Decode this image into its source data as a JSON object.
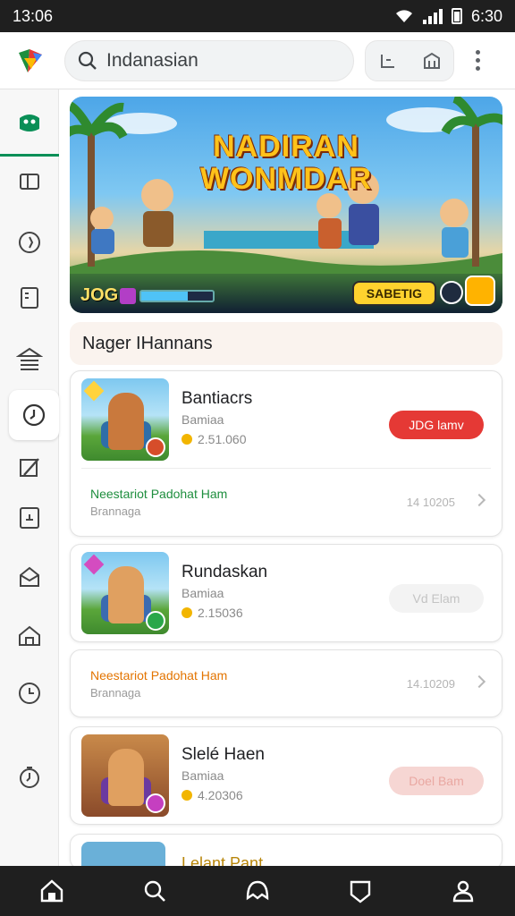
{
  "status_bar": {
    "time": "13:06",
    "clock": "6:30"
  },
  "search": {
    "query": "Indanasian"
  },
  "banner": {
    "title_line1": "NADIRAN",
    "title_line2": "WONMDAR",
    "score": "JOG",
    "progress_fraction": 0.65,
    "cta_label": "SABETIG"
  },
  "section": {
    "title": "Nager IHannans"
  },
  "cards": [
    {
      "title": "Bantiacrs",
      "subtitle": "Bamiaa",
      "meta": "2.51.060",
      "button": "JDG lamv",
      "button_style": "red"
    },
    {
      "title": "Rundaskan",
      "subtitle": "Bamiaa",
      "meta": "2.15036",
      "button": "Vd Elam",
      "button_style": "ghost"
    },
    {
      "title": "Slelé Haen",
      "subtitle": "Bamiaa",
      "meta": "4.20306",
      "button": "Doel Bam",
      "button_style": "pink"
    }
  ],
  "rows": [
    {
      "title": "Neestariot Padohat Ham",
      "subtitle": "Brannaga",
      "value": "14 10205",
      "color": "#1e8e3e"
    },
    {
      "title": "Neestariot Padohat Ham",
      "subtitle": "Brannaga",
      "value": "14.10209",
      "color": "#e37400"
    }
  ],
  "partial_card": {
    "title": "Lelant Pant"
  },
  "colors": {
    "accent_green": "#0a8f57",
    "primary_red": "#e53935"
  }
}
